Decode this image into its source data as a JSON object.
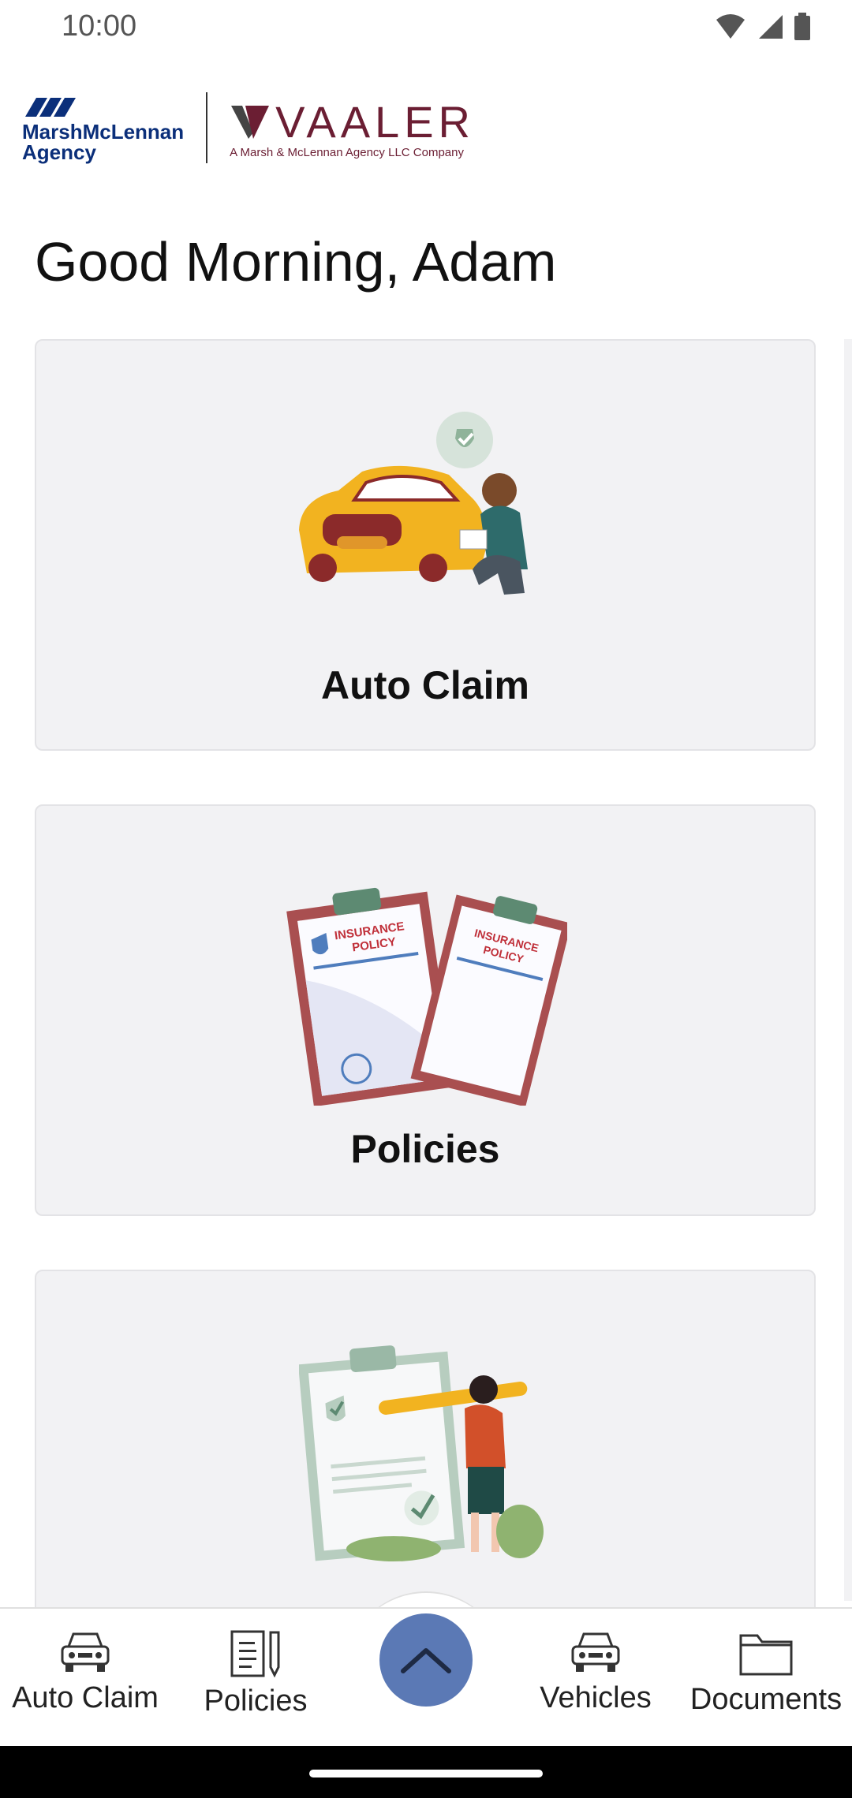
{
  "status": {
    "time": "10:00",
    "icons": [
      "wifi-icon",
      "signal-icon",
      "battery-icon"
    ]
  },
  "brand": {
    "marsh_lines": [
      "MarshMcLennan",
      "Agency"
    ],
    "vaaler_name": "VAALER",
    "vaaler_tagline": "A Marsh & McLennan Agency LLC Company",
    "colors": {
      "marsh_blue": "#0b2f7a",
      "vaaler_maroon": "#6b1e33"
    }
  },
  "greeting": "Good Morning, Adam",
  "cards": [
    {
      "title": "Auto Claim",
      "icon": "auto-claim-illustration"
    },
    {
      "title": "Policies",
      "icon": "insurance-policy-illustration"
    },
    {
      "title": "",
      "icon": "checklist-illustration"
    }
  ],
  "bottom_nav": {
    "items": [
      {
        "label": "Auto Claim",
        "icon": "car-icon"
      },
      {
        "label": "Policies",
        "icon": "document-pen-icon"
      },
      {
        "label": "Vehicles",
        "icon": "car-icon"
      },
      {
        "label": "Documents",
        "icon": "folder-icon"
      }
    ],
    "fab_icon": "chevron-up-icon",
    "fab_color": "#5b79b5"
  }
}
